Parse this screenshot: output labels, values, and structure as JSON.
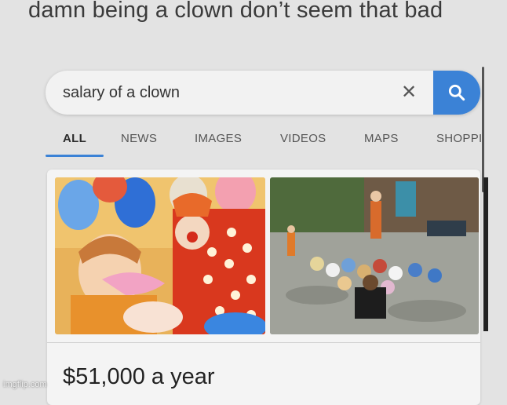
{
  "caption": "damn being a clown don’t seem that bad",
  "search": {
    "query": "salary of a clown",
    "clear_glyph": "✕",
    "search_icon": "search-icon"
  },
  "tabs": [
    {
      "label": "ALL",
      "active": true
    },
    {
      "label": "NEWS"
    },
    {
      "label": "IMAGES"
    },
    {
      "label": "VIDEOS"
    },
    {
      "label": "MAPS"
    },
    {
      "label": "SHOPPING"
    }
  ],
  "result": {
    "salary_text": "$51,000 a year"
  },
  "watermark": "imgflip.com",
  "colors": {
    "accent": "#3b82d6",
    "background": "#e3e3e3"
  }
}
